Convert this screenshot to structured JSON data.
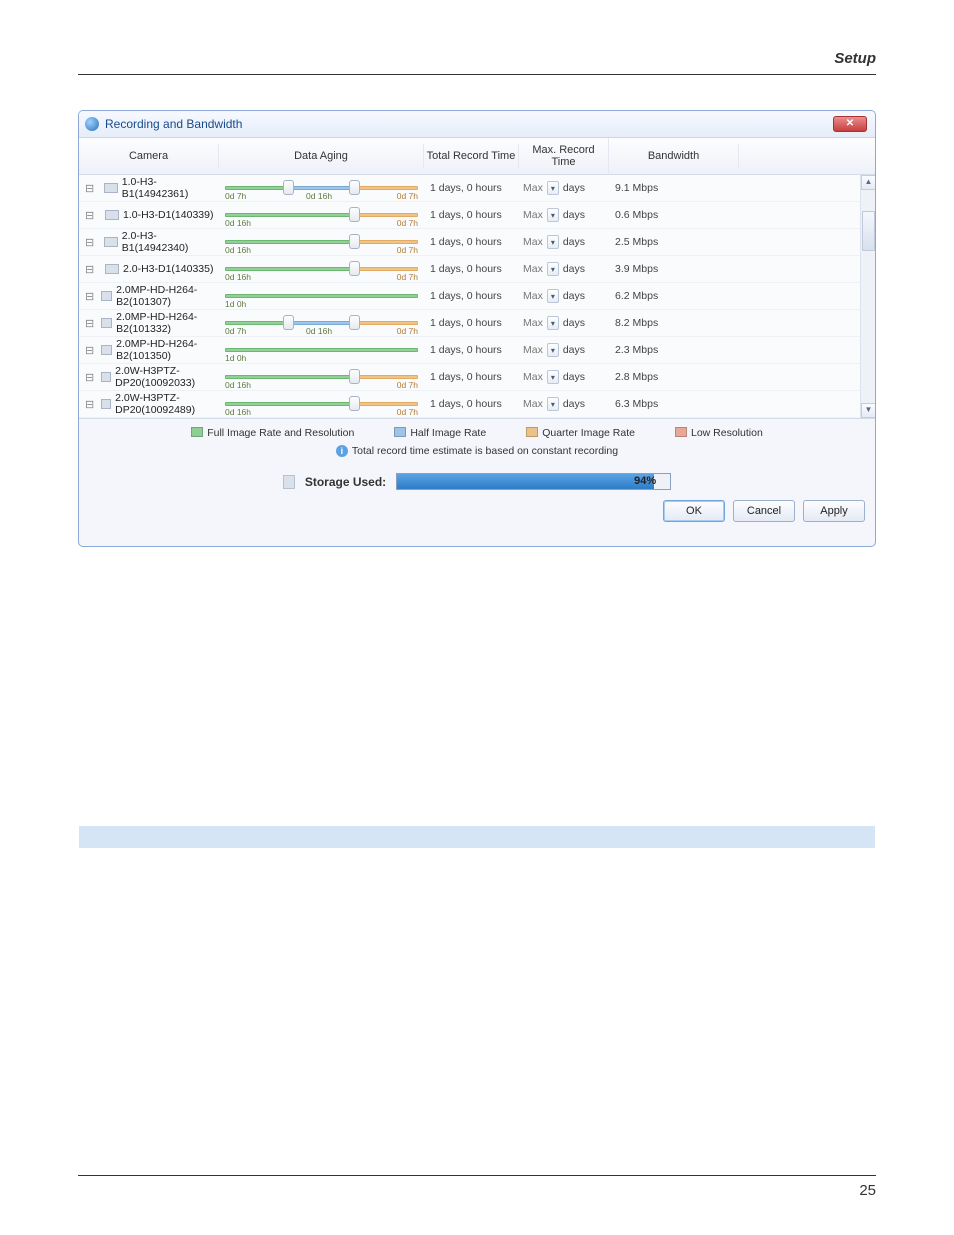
{
  "page_header": {
    "section": "Setup",
    "page_number": "25"
  },
  "dialog": {
    "title": "Recording and Bandwidth",
    "columns": {
      "camera": "Camera",
      "data_aging": "Data Aging",
      "total_record": "Total Record Time",
      "max_record": "Max. Record Time",
      "bandwidth": "Bandwidth"
    },
    "rows": [
      {
        "camera": "1.0-H3-B1(14942361)",
        "aging": {
          "type": "g_b_o",
          "l1": "0d 7h",
          "l2": "0d 16h",
          "l3": "0d 7h"
        },
        "total": "1 days, 0 hours",
        "max_val": "Max",
        "max_unit": "days",
        "bw": "9.1 Mbps"
      },
      {
        "camera": "1.0-H3-D1(140339)",
        "aging": {
          "type": "g_o",
          "l1": "0d 16h",
          "l3": "0d 7h"
        },
        "total": "1 days, 0 hours",
        "max_val": "Max",
        "max_unit": "days",
        "bw": "0.6 Mbps"
      },
      {
        "camera": "2.0-H3-B1(14942340)",
        "aging": {
          "type": "g_o",
          "l1": "0d 16h",
          "l3": "0d 7h"
        },
        "total": "1 days, 0 hours",
        "max_val": "Max",
        "max_unit": "days",
        "bw": "2.5 Mbps"
      },
      {
        "camera": "2.0-H3-D1(140335)",
        "aging": {
          "type": "g_o",
          "l1": "0d 16h",
          "l3": "0d 7h"
        },
        "total": "1 days, 0 hours",
        "max_val": "Max",
        "max_unit": "days",
        "bw": "3.9 Mbps"
      },
      {
        "camera": "2.0MP-HD-H264-B2(101307)",
        "aging": {
          "type": "g_only",
          "l1": "1d 0h"
        },
        "total": "1 days, 0 hours",
        "max_val": "Max",
        "max_unit": "days",
        "bw": "6.2 Mbps"
      },
      {
        "camera": "2.0MP-HD-H264-B2(101332)",
        "aging": {
          "type": "g_b_o",
          "l1": "0d 7h",
          "l2": "0d 16h",
          "l3": "0d 7h"
        },
        "total": "1 days, 0 hours",
        "max_val": "Max",
        "max_unit": "days",
        "bw": "8.2 Mbps"
      },
      {
        "camera": "2.0MP-HD-H264-B2(101350)",
        "aging": {
          "type": "g_only",
          "l1": "1d 0h"
        },
        "total": "1 days, 0 hours",
        "max_val": "Max",
        "max_unit": "days",
        "bw": "2.3 Mbps"
      },
      {
        "camera": "2.0W-H3PTZ-DP20(10092033)",
        "aging": {
          "type": "g_o",
          "l1": "0d 16h",
          "l3": "0d 7h"
        },
        "total": "1 days, 0 hours",
        "max_val": "Max",
        "max_unit": "days",
        "bw": "2.8 Mbps"
      },
      {
        "camera": "2.0W-H3PTZ-DP20(10092489)",
        "aging": {
          "type": "g_o",
          "l1": "0d 16h",
          "l3": "0d 7h"
        },
        "total": "1 days, 0 hours",
        "max_val": "Max",
        "max_unit": "days",
        "bw": "6.3 Mbps"
      }
    ],
    "legend": {
      "full": "Full Image Rate and Resolution",
      "half": "Half Image Rate",
      "quarter": "Quarter Image Rate",
      "low": "Low Resolution"
    },
    "info": "Total record time estimate is based on constant recording",
    "storage": {
      "label": "Storage Used:",
      "percent_text": "94%",
      "percent_value": 94
    },
    "buttons": {
      "ok": "OK",
      "cancel": "Cancel",
      "apply": "Apply"
    }
  }
}
